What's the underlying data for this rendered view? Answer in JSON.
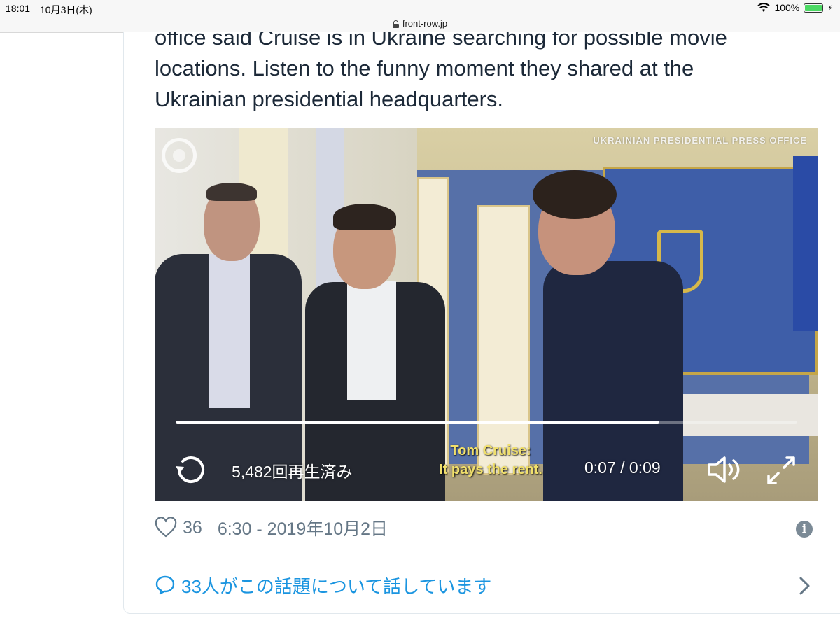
{
  "status_bar": {
    "time": "18:01",
    "date": "10月3日(木)",
    "battery_percent": "100%",
    "battery_level": 1.0,
    "icons": [
      "wifi-icon",
      "battery-icon",
      "charging-bolt-icon"
    ]
  },
  "browser": {
    "url": "front-row.jp"
  },
  "tweet": {
    "text": "office said Cruise is in Ukraine searching for possible movie\nlocations. Listen to the funny moment they shared at the\nUkrainian presidential headquarters.",
    "video": {
      "press_label": "UKRAINIAN PRESIDENTIAL PRESS OFFICE",
      "subtitle_line1": "Tom Cruise:",
      "subtitle_line2": "It pays the rent.",
      "views": "5,482回再生済み",
      "time": "0:07 / 0:09",
      "progress": 0.778,
      "icons": [
        "replay-icon",
        "volume-icon",
        "fullscreen-icon"
      ]
    },
    "likes": "36",
    "timestamp": "6:30 - 2019年10月2日",
    "conversation": "33人がこの話題について話しています",
    "colors": {
      "link_blue": "#1b95e0",
      "meta_gray": "#657786"
    }
  }
}
